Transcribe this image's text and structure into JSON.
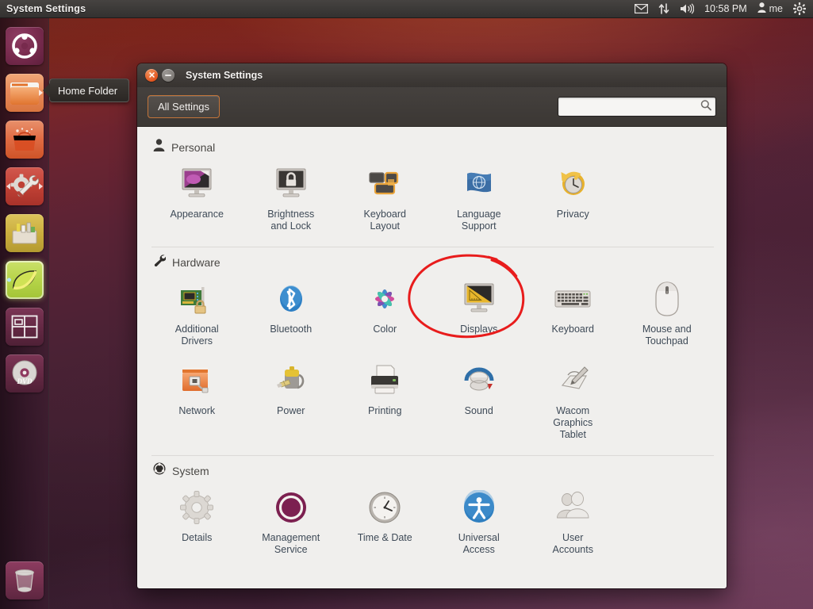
{
  "panel": {
    "title": "System Settings",
    "clock": "10:58 PM",
    "user": "me",
    "indicators": [
      {
        "name": "messaging-icon",
        "glyph": "envelope"
      },
      {
        "name": "network-icon",
        "glyph": "up-down-arrows"
      },
      {
        "name": "sound-icon",
        "glyph": "speaker"
      },
      {
        "name": "session-gear-icon",
        "glyph": "gear"
      }
    ]
  },
  "launcher": {
    "tooltip": "Home Folder",
    "items": [
      {
        "name": "dash-home",
        "label": "Ubuntu Dash"
      },
      {
        "name": "home-folder",
        "label": "Home Folder"
      },
      {
        "name": "ubuntu-software-center",
        "label": "Ubuntu Software Center"
      },
      {
        "name": "system-settings",
        "label": "System Settings"
      },
      {
        "name": "ubuntu-one",
        "label": "Ubuntu One"
      },
      {
        "name": "libreoffice-impress",
        "label": "LibreOffice Impress"
      },
      {
        "name": "workspace-switcher",
        "label": "Workspace Switcher"
      },
      {
        "name": "dvd-media",
        "label": "DVD"
      }
    ],
    "trash": {
      "name": "trash",
      "label": "Trash"
    }
  },
  "window": {
    "title": "System Settings",
    "close_label": "×",
    "minimize_label": "−",
    "all_settings_label": "All Settings",
    "search": {
      "value": "",
      "placeholder": ""
    }
  },
  "sections": [
    {
      "id": "personal",
      "title": "Personal",
      "icon": "person-icon",
      "tiles": [
        {
          "id": "appearance",
          "label": "Appearance",
          "icon": "monitor-wallpaper-icon"
        },
        {
          "id": "brightness-and-lock",
          "label": "Brightness\nand Lock",
          "icon": "monitor-lock-icon"
        },
        {
          "id": "keyboard-layout",
          "label": "Keyboard\nLayout",
          "icon": "keyboard-layout-icon"
        },
        {
          "id": "language-support",
          "label": "Language\nSupport",
          "icon": "flag-globe-icon"
        },
        {
          "id": "privacy",
          "label": "Privacy",
          "icon": "clock-rewind-icon"
        }
      ]
    },
    {
      "id": "hardware",
      "title": "Hardware",
      "icon": "wrench-icon",
      "tiles": [
        {
          "id": "additional-drivers",
          "label": "Additional\nDrivers",
          "icon": "circuit-board-lock-icon"
        },
        {
          "id": "bluetooth",
          "label": "Bluetooth",
          "icon": "bluetooth-icon"
        },
        {
          "id": "color",
          "label": "Color",
          "icon": "color-wheel-icon"
        },
        {
          "id": "displays",
          "label": "Displays",
          "icon": "monitor-ruler-icon",
          "annotated": true
        },
        {
          "id": "keyboard",
          "label": "Keyboard",
          "icon": "keyboard-icon"
        },
        {
          "id": "mouse-and-touchpad",
          "label": "Mouse and\nTouchpad",
          "icon": "mouse-icon"
        },
        {
          "id": "network",
          "label": "Network",
          "icon": "network-folder-icon"
        },
        {
          "id": "power",
          "label": "Power",
          "icon": "battery-plug-icon"
        },
        {
          "id": "printing",
          "label": "Printing",
          "icon": "printer-icon"
        },
        {
          "id": "sound",
          "label": "Sound",
          "icon": "volume-knob-icon"
        },
        {
          "id": "wacom-graphics-tablet",
          "label": "Wacom\nGraphics\nTablet",
          "icon": "tablet-stylus-icon"
        }
      ]
    },
    {
      "id": "system",
      "title": "System",
      "icon": "ubuntu-logo-icon",
      "tiles": [
        {
          "id": "details",
          "label": "Details",
          "icon": "gear-icon"
        },
        {
          "id": "management-service",
          "label": "Management\nService",
          "icon": "ubuntu-ring-icon"
        },
        {
          "id": "time-and-date",
          "label": "Time & Date",
          "icon": "analog-clock-icon"
        },
        {
          "id": "universal-access",
          "label": "Universal\nAccess",
          "icon": "accessibility-icon"
        },
        {
          "id": "user-accounts",
          "label": "User\nAccounts",
          "icon": "users-icon"
        }
      ]
    }
  ],
  "annotation": {
    "target": "displays",
    "shape": "hand-drawn-ellipse",
    "color": "#e81c1c"
  },
  "colors": {
    "accent_orange": "#e2551f",
    "window_chrome": "#403c39",
    "content_bg": "#f0efed",
    "label_text": "#3e4a57",
    "annotation_red": "#e81c1c"
  }
}
